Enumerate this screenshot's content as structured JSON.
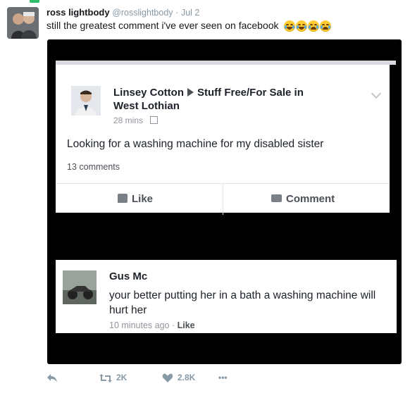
{
  "tweet": {
    "author_name": "ross lightbody",
    "handle": "@rosslightbody",
    "separator": "·",
    "date": "Jul 2",
    "text": "still the greatest comment i've ever seen on facebook",
    "emojis": [
      "face-with-tears-of-joy",
      "face-with-tears-of-joy",
      "loudly-crying-face",
      "loudly-crying-face"
    ]
  },
  "facebook_post": {
    "poster": "Linsey Cotton",
    "group_line1": "Stuff Free/For Sale in",
    "group_line2": "West Lothian",
    "time": "28 mins",
    "body": "Looking for a washing machine for my disabled sister",
    "comments_count": "13 comments",
    "like_label": "Like",
    "comment_label": "Comment"
  },
  "facebook_comment": {
    "author": "Gus Mc",
    "text": "your better putting her in a bath a washing machine will hurt her",
    "time": "10 minutes ago",
    "separator": "·",
    "like_label": "Like"
  },
  "actions": {
    "retweet_count": "2K",
    "like_count": "2.8K",
    "more_label": "•••"
  },
  "colors": {
    "meta_gray": "#8899a6",
    "fb_text": "#1d2129",
    "green_accent": "#2fbd6a"
  }
}
